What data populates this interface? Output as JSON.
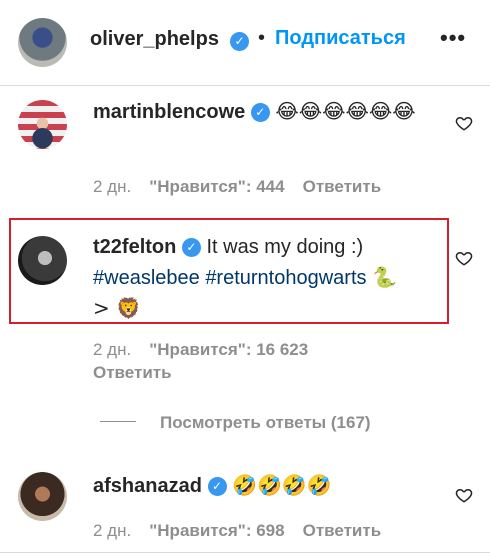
{
  "header": {
    "username": "oliver_phelps",
    "separator": "•",
    "follow_label": "Подписаться",
    "more_label": "•••",
    "verified_mark": "✓"
  },
  "comments": [
    {
      "username": "martinblencowe",
      "text": "😂😂😂😂😂😂",
      "time": "2 дн.",
      "likes": "\"Нравится\": 444",
      "reply_label": "Ответить"
    },
    {
      "username": "t22felton",
      "text": "It was my doing :)",
      "hashtags": [
        "#weaslebee",
        "#returntohogwarts"
      ],
      "trailing": "🐍 > 🦁",
      "time": "2 дн.",
      "likes": "\"Нравится\": 16 623",
      "reply_label": "Ответить"
    },
    {
      "username": "afshanazad",
      "text": "🤣🤣🤣🤣",
      "time": "2 дн.",
      "likes": "\"Нравится\": 698",
      "reply_label": "Ответить"
    }
  ],
  "view_replies_label": "Посмотреть ответы (167)",
  "icons": {
    "verified": "verified-badge-icon",
    "heart": "heart-outline-icon",
    "more": "more-horizontal-icon"
  },
  "colors": {
    "link_blue": "#0095f6",
    "hashtag": "#00376b",
    "muted": "#8e8e8e",
    "highlight_border": "#d1202f",
    "verified": "#3897f0"
  }
}
